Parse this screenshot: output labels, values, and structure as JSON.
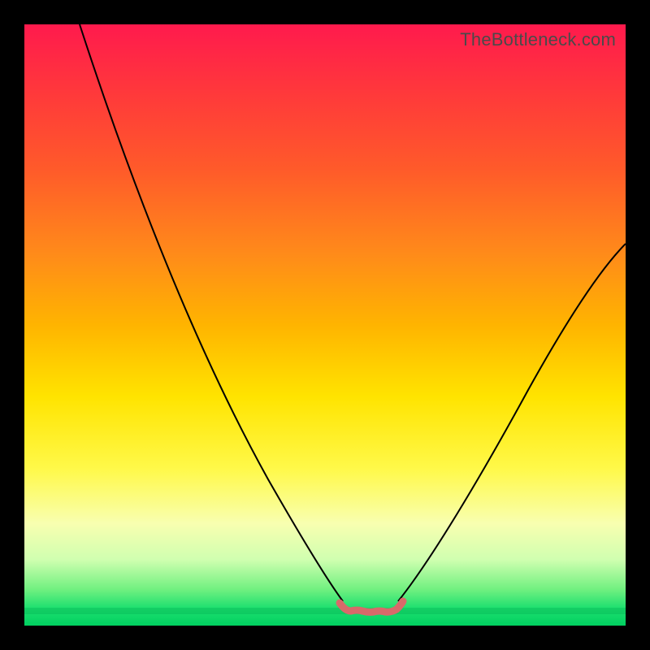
{
  "watermark": "TheBottleneck.com",
  "chart_data": {
    "type": "line",
    "title": "",
    "xlabel": "",
    "ylabel": "",
    "xlim": [
      0,
      100
    ],
    "ylim": [
      0,
      100
    ],
    "grid": false,
    "legend": false,
    "annotations": [],
    "series": [
      {
        "name": "left-branch",
        "x": [
          10,
          15,
          20,
          25,
          30,
          35,
          40,
          45,
          50,
          53
        ],
        "values": [
          100,
          90,
          78,
          66,
          54,
          42,
          30,
          18,
          7,
          2
        ]
      },
      {
        "name": "right-branch",
        "x": [
          62,
          65,
          70,
          75,
          80,
          85,
          90,
          95,
          100
        ],
        "values": [
          2,
          4,
          9,
          16,
          24,
          33,
          42,
          52,
          62
        ]
      },
      {
        "name": "optimal-band",
        "x": [
          53,
          55,
          57,
          59,
          61,
          62
        ],
        "values": [
          2,
          1,
          1,
          1,
          1,
          2
        ]
      }
    ],
    "background_gradient": {
      "top_color": "#ff1a4d",
      "mid_color": "#ffe400",
      "bottom_color": "#00d060"
    }
  }
}
